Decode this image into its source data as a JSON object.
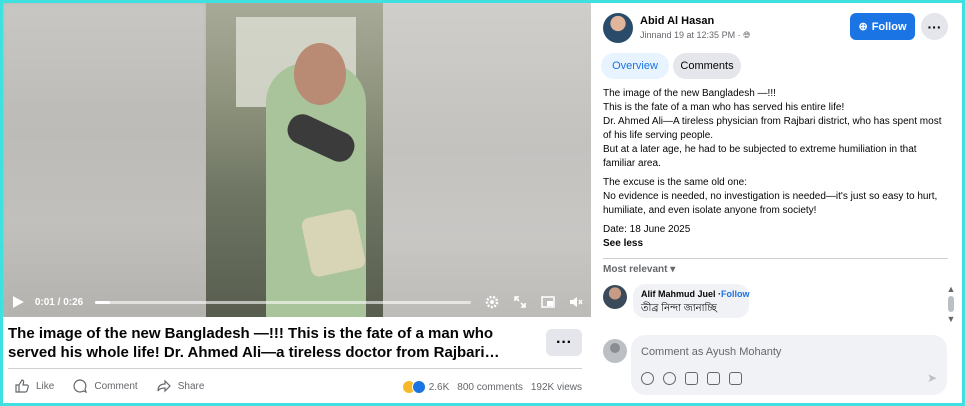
{
  "video": {
    "time": "0:01 / 0:26",
    "progress": 0.04
  },
  "post": {
    "caption": "The image of the new Bangladesh —!!! This is the fate of a man who served his whole life! Dr. Ahmed Ali—a tireless doctor from Rajbari…",
    "more_label": "···"
  },
  "actions": {
    "like": "Like",
    "comment": "Comment",
    "share": "Share"
  },
  "stats": {
    "reactions": "2.6K",
    "comments": "800 comments",
    "views": "192K views"
  },
  "panel": {
    "author": "Abid Al Hasan",
    "time": "Jinnand 19 at 12:35 PM ·",
    "follow": "Follow",
    "more": "···",
    "tabs": [
      "Overview",
      "Comments"
    ],
    "body": {
      "p1": [
        "The image of the new Bangladesh —!!!",
        "This is the fate of a man who has served his entire life!",
        "Dr. Ahmed Ali—A tireless physician from Rajbari district, who has spent most of his life serving people.",
        "But at a later age, he had to be subjected to extreme humiliation in that familiar area."
      ],
      "p2": [
        "The excuse is the same old one:",
        "No evidence is needed, no investigation is needed—it's just so easy to hurt, humiliate, and even isolate anyone from society!"
      ],
      "date": "Date: 18 June 2025",
      "see_less": "See less"
    },
    "most_relevant": "Most relevant ▾",
    "comment": {
      "author": "Alif Mahmud Juel",
      "follow": "Follow",
      "text": "তীব্র নিন্দা জানাচ্ছি"
    },
    "composer_placeholder": "Comment as Ayush Mohanty",
    "send_icon": "paper-plane-icon"
  }
}
